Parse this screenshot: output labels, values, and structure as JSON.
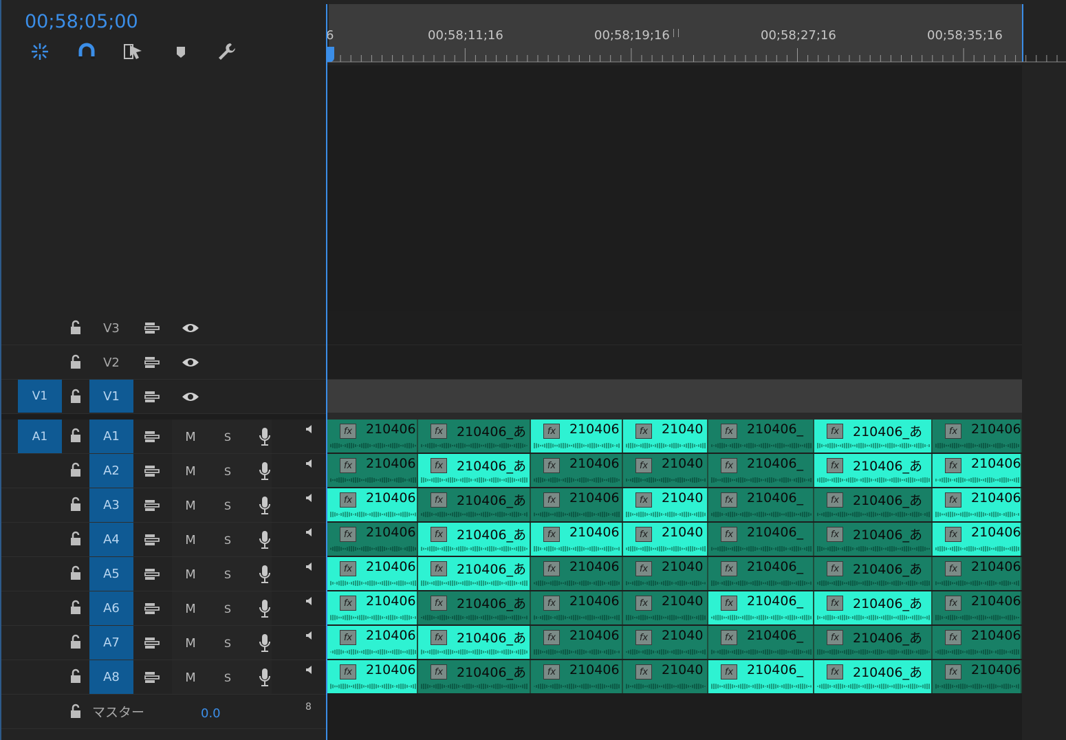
{
  "timecode": "00;58;05;00",
  "toolbar": {
    "tools": [
      "snap-nested-icon",
      "magnet-icon",
      "linked-selection-icon",
      "marker-icon",
      "wrench-icon"
    ]
  },
  "ruler": {
    "labels": [
      "6",
      "00;58;11;16",
      "00;58;19;16",
      "00;58;27;16",
      "00;58;35;16"
    ]
  },
  "video_tracks": [
    {
      "source": "",
      "target": "V3"
    },
    {
      "source": "",
      "target": "V2"
    },
    {
      "source": "V1",
      "target": "V1"
    }
  ],
  "audio_tracks": [
    {
      "source": "A1",
      "target": "A1"
    },
    {
      "source": "",
      "target": "A2"
    },
    {
      "source": "",
      "target": "A3"
    },
    {
      "source": "",
      "target": "A4"
    },
    {
      "source": "",
      "target": "A5"
    },
    {
      "source": "",
      "target": "A6"
    },
    {
      "source": "",
      "target": "A7"
    },
    {
      "source": "",
      "target": "A8"
    }
  ],
  "track_buttons": {
    "mute": "M",
    "solo": "S"
  },
  "master": {
    "label": "マスター",
    "value": "0.0",
    "channels": "8"
  },
  "clip_names": [
    "210406",
    "210406_あ",
    "210406",
    "21040",
    "210406_",
    "210406_あ",
    "210406"
  ],
  "colors": {
    "accent": "#3b8ee8",
    "clip_light": "#2ef2d2",
    "clip_dark": "#188066",
    "patch": "#0f5a94"
  },
  "clip_pattern": [
    [
      "dark",
      "dark",
      "light",
      "light",
      "dark",
      "light",
      "dark"
    ],
    [
      "dark",
      "light",
      "dark",
      "dark",
      "dark",
      "light",
      "light"
    ],
    [
      "light",
      "dark",
      "dark",
      "light",
      "dark",
      "dark",
      "light"
    ],
    [
      "dark",
      "light",
      "light",
      "light",
      "dark",
      "dark",
      "light"
    ],
    [
      "light",
      "light",
      "dark",
      "dark",
      "dark",
      "dark",
      "dark"
    ],
    [
      "light",
      "dark",
      "dark",
      "dark",
      "light",
      "light",
      "dark"
    ],
    [
      "light",
      "light",
      "dark",
      "dark",
      "dark",
      "dark",
      "dark"
    ],
    [
      "light",
      "dark",
      "dark",
      "dark",
      "light",
      "light",
      "dark"
    ]
  ]
}
